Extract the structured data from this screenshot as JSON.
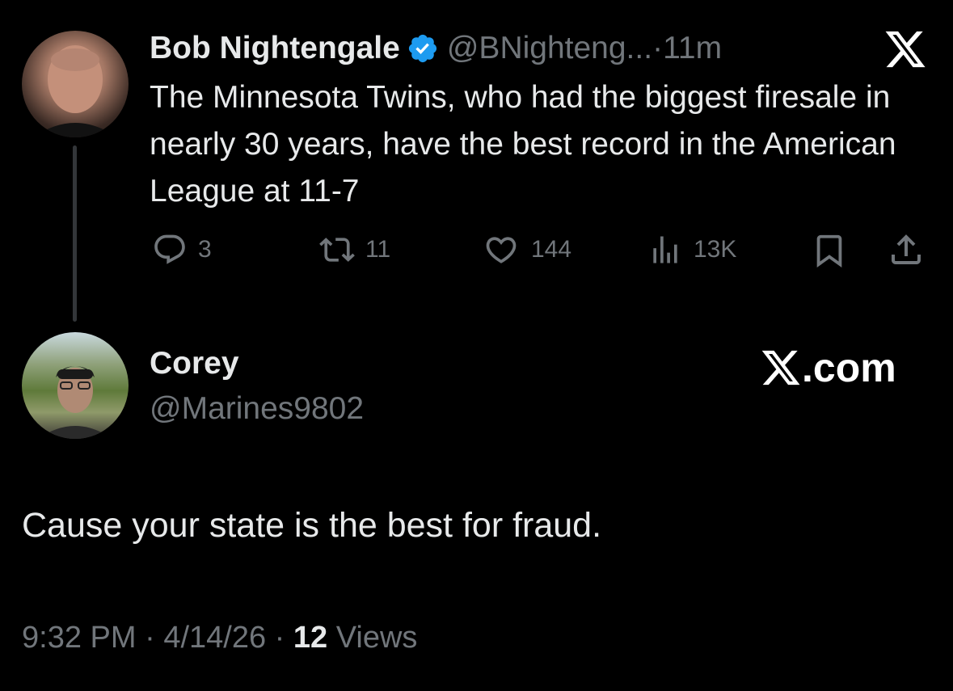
{
  "original_tweet": {
    "display_name": "Bob Nightengale",
    "handle": "@BNighteng...",
    "time_separator": " · ",
    "time_ago": "11m",
    "text": "The Minnesota Twins, who had the biggest firesale in nearly 30 years, have the best record in the American League at 11-7",
    "actions": {
      "replies": "3",
      "reposts": "11",
      "likes": "144",
      "views": "13K"
    }
  },
  "reply": {
    "display_name": "Corey",
    "handle": "@Marines9802",
    "text": "Cause your state is the best for fraud.",
    "meta": {
      "time": "9:32 PM",
      "sep1": " · ",
      "date": "4/14/26",
      "sep2": " · ",
      "views_count": "12",
      "views_label": " Views"
    }
  },
  "branding": {
    "x_com_suffix": ".com"
  },
  "colors": {
    "background": "#000000",
    "primary_text": "#e7e9ea",
    "secondary_text": "#71767b",
    "verified_blue": "#1d9bf0"
  },
  "icons": [
    "verified-badge-icon",
    "x-logo-icon",
    "reply-icon",
    "repost-icon",
    "like-icon",
    "views-icon",
    "bookmark-icon",
    "share-icon"
  ]
}
